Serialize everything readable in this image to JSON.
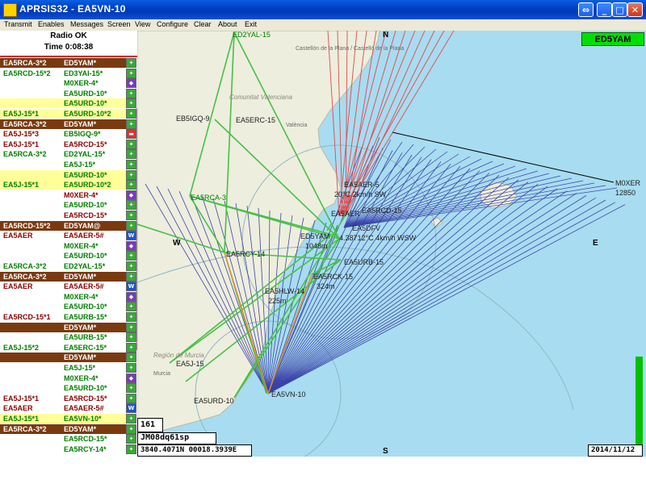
{
  "window": {
    "title": "APRSIS32 - EA5VN-10"
  },
  "menu": [
    "Transmit",
    "Enables",
    "Messages",
    "Screen",
    "View",
    "Configure",
    "Clear",
    "About",
    "Exit"
  ],
  "status": {
    "line1": "Radio OK",
    "line2": "Time 0:08:38"
  },
  "list": [
    {
      "c1": "EA5RCA-3*2",
      "c2": "ED5YAM*",
      "bg": "#7a3a10",
      "fg1": "#ffffff",
      "fg2": "#ffffff",
      "icon": "digi-icon"
    },
    {
      "c1": "EA5RCD-15*2",
      "c2": "ED3YAI-15*",
      "bg": "#ffffff",
      "fg1": "#008000",
      "fg2": "#008000",
      "icon": "digi-icon"
    },
    {
      "c1": "",
      "c2": "M0XER-4*",
      "bg": "#ffffff",
      "fg1": "#008000",
      "fg2": "#008000",
      "icon": "balloon-icon"
    },
    {
      "c1": "",
      "c2": "EA5URD-10*",
      "bg": "#ffffff",
      "fg1": "#008000",
      "fg2": "#008000",
      "icon": "digi-icon"
    },
    {
      "c1": "",
      "c2": "EA5URD-10*",
      "bg": "#ffff99",
      "fg1": "#008000",
      "fg2": "#008000",
      "icon": "digi-icon"
    },
    {
      "c1": "EA5J-15*1",
      "c2": "EA5URD-10*2",
      "bg": "#ffff99",
      "fg1": "#008000",
      "fg2": "#008000",
      "icon": "digi-icon"
    },
    {
      "c1": "EA5RCA-3*2",
      "c2": "ED5YAM*",
      "bg": "#7a3a10",
      "fg1": "#ffffff",
      "fg2": "#ffffff",
      "icon": "digi-icon"
    },
    {
      "c1": "EA5J-15*3",
      "c2": "EB5IGQ-9*",
      "bg": "#ffffff",
      "fg1": "#8b0000",
      "fg2": "#008000",
      "icon": "car-icon"
    },
    {
      "c1": "EA5J-15*1",
      "c2": "EA5RCD-15*",
      "bg": "#ffffff",
      "fg1": "#8b0000",
      "fg2": "#8b0000",
      "icon": "digi-icon"
    },
    {
      "c1": "EA5RCA-3*2",
      "c2": "ED2YAL-15*",
      "bg": "#ffffff",
      "fg1": "#008000",
      "fg2": "#008000",
      "icon": "digi-icon"
    },
    {
      "c1": "",
      "c2": "EA5J-15*",
      "bg": "#ffffff",
      "fg1": "#008000",
      "fg2": "#008000",
      "icon": "digi-icon"
    },
    {
      "c1": "",
      "c2": "EA5URD-10*",
      "bg": "#ffff99",
      "fg1": "#008000",
      "fg2": "#008000",
      "icon": "digi-icon"
    },
    {
      "c1": "EA5J-15*1",
      "c2": "EA5URD-10*2",
      "bg": "#ffff99",
      "fg1": "#008000",
      "fg2": "#008000",
      "icon": "digi-icon"
    },
    {
      "c1": "",
      "c2": "M0XER-4*",
      "bg": "#ffffff",
      "fg1": "#008000",
      "fg2": "#8b0000",
      "icon": "balloon-icon"
    },
    {
      "c1": "",
      "c2": "EA5URD-10*",
      "bg": "#ffffff",
      "fg1": "#008000",
      "fg2": "#008000",
      "icon": "digi-icon"
    },
    {
      "c1": "",
      "c2": "EA5RCD-15*",
      "bg": "#ffffff",
      "fg1": "#8b0000",
      "fg2": "#8b0000",
      "icon": "digi-icon"
    },
    {
      "c1": "EA5RCD-15*2",
      "c2": "ED5YAM@",
      "bg": "#7a3a10",
      "fg1": "#ffffff",
      "fg2": "#ffffff",
      "icon": "digi-icon"
    },
    {
      "c1": "EA5AER",
      "c2": "EA5AER-5#",
      "bg": "#ffffff",
      "fg1": "#8b0000",
      "fg2": "#8b0000",
      "icon": "wx-icon"
    },
    {
      "c1": "",
      "c2": "M0XER-4*",
      "bg": "#ffffff",
      "fg1": "#008000",
      "fg2": "#008000",
      "icon": "balloon-icon"
    },
    {
      "c1": "",
      "c2": "EA5URD-10*",
      "bg": "#ffffff",
      "fg1": "#008000",
      "fg2": "#008000",
      "icon": "digi-icon"
    },
    {
      "c1": "EA5RCA-3*2",
      "c2": "ED2YAL-15*",
      "bg": "#ffffff",
      "fg1": "#008000",
      "fg2": "#008000",
      "icon": "digi-icon"
    },
    {
      "c1": "EA5RCA-3*2",
      "c2": "ED5YAM*",
      "bg": "#7a3a10",
      "fg1": "#ffffff",
      "fg2": "#ffffff",
      "icon": "digi-icon"
    },
    {
      "c1": "EA5AER",
      "c2": "EA5AER-5#",
      "bg": "#ffffff",
      "fg1": "#8b0000",
      "fg2": "#8b0000",
      "icon": "wx-icon"
    },
    {
      "c1": "",
      "c2": "M0XER-4*",
      "bg": "#ffffff",
      "fg1": "#008000",
      "fg2": "#008000",
      "icon": "balloon-icon"
    },
    {
      "c1": "",
      "c2": "EA5URD-10*",
      "bg": "#ffffff",
      "fg1": "#008000",
      "fg2": "#008000",
      "icon": "digi-icon"
    },
    {
      "c1": "EA5RCD-15*1",
      "c2": "EA5URB-15*",
      "bg": "#ffffff",
      "fg1": "#8b0000",
      "fg2": "#008000",
      "icon": "digi-icon"
    },
    {
      "c1": "",
      "c2": "ED5YAM*",
      "bg": "#7a3a10",
      "fg1": "#ffffff",
      "fg2": "#ffffff",
      "icon": "digi-icon"
    },
    {
      "c1": "",
      "c2": "EA5URB-15*",
      "bg": "#ffffff",
      "fg1": "#008000",
      "fg2": "#008000",
      "icon": "digi-icon"
    },
    {
      "c1": "EA5J-15*2",
      "c2": "EA5ERC-15*",
      "bg": "#ffffff",
      "fg1": "#008000",
      "fg2": "#008000",
      "icon": "digi-icon"
    },
    {
      "c1": "",
      "c2": "ED5YAM*",
      "bg": "#7a3a10",
      "fg1": "#ffffff",
      "fg2": "#ffffff",
      "icon": "digi-icon"
    },
    {
      "c1": "",
      "c2": "EA5J-15*",
      "bg": "#ffffff",
      "fg1": "#008000",
      "fg2": "#008000",
      "icon": "digi-icon"
    },
    {
      "c1": "",
      "c2": "M0XER-4*",
      "bg": "#ffffff",
      "fg1": "#008000",
      "fg2": "#008000",
      "icon": "balloon-icon"
    },
    {
      "c1": "",
      "c2": "EA5URD-10*",
      "bg": "#ffffff",
      "fg1": "#008000",
      "fg2": "#008000",
      "icon": "digi-icon"
    },
    {
      "c1": "EA5J-15*1",
      "c2": "EA5RCD-15*",
      "bg": "#ffffff",
      "fg1": "#8b0000",
      "fg2": "#8b0000",
      "icon": "digi-icon"
    },
    {
      "c1": "EA5AER",
      "c2": "EA5AER-5#",
      "bg": "#ffffff",
      "fg1": "#8b0000",
      "fg2": "#8b0000",
      "icon": "wx-icon"
    },
    {
      "c1": "EA5J-15*1",
      "c2": "EA5VN-10*",
      "bg": "#ffff99",
      "fg1": "#008000",
      "fg2": "#008000",
      "icon": "digi-icon"
    },
    {
      "c1": "EA5RCA-3*2",
      "c2": "ED5YAM*",
      "bg": "#7a3a10",
      "fg1": "#ffffff",
      "fg2": "#ffffff",
      "icon": "digi-icon"
    },
    {
      "c1": "",
      "c2": "EA5RCD-15*",
      "bg": "#ffffff",
      "fg1": "#008000",
      "fg2": "#008000",
      "icon": "digi-icon"
    },
    {
      "c1": "",
      "c2": "EA5RCY-14*",
      "bg": "#ffffff",
      "fg1": "#008000",
      "fg2": "#008000",
      "icon": "digi-icon"
    }
  ],
  "scroll": {
    "up": "+",
    "down": "-"
  },
  "map": {
    "compass": {
      "n": "N",
      "s": "S",
      "e": "E",
      "w": "W"
    },
    "stations": [
      {
        "label": "ED2YAL-15",
        "color": "#008000"
      },
      {
        "label": "EB5IGQ-9",
        "color": "#202020"
      },
      {
        "label": "EA5ERC-15",
        "color": "#202020"
      },
      {
        "label": "EA5RCA-3",
        "color": "#008000"
      },
      {
        "label": "EA5AER-5",
        "color": "#202020"
      },
      {
        "label": "20°C 2km/h SW",
        "color": "#202020"
      },
      {
        "label": "EA5AER",
        "color": "#202020"
      },
      {
        "label": "EA5RCD-15",
        "color": "#202020"
      },
      {
        "label": "EA5DFV",
        "color": "#202020"
      },
      {
        "label": "ED5YAM",
        "color": "#202020"
      },
      {
        "label": "1048m",
        "color": "#202020"
      },
      {
        "label": "4.38712°C 4km/h WSW",
        "color": "#202020"
      },
      {
        "label": "EA5URB-15",
        "color": "#202020"
      },
      {
        "label": "EA5RCY-14",
        "color": "#202020"
      },
      {
        "label": "EA5RCK-15",
        "color": "#202020"
      },
      {
        "label": "324m",
        "color": "#202020"
      },
      {
        "label": "EA5HLW-14",
        "color": "#202020"
      },
      {
        "label": "225m",
        "color": "#202020"
      },
      {
        "label": "EA5J-15",
        "color": "#202020"
      },
      {
        "label": "EA5URD-10",
        "color": "#202020"
      },
      {
        "label": "EA5VN-10",
        "color": "#202020"
      },
      {
        "label": "M0XER",
        "color": "#202020"
      },
      {
        "label": "12850",
        "color": "#202020"
      }
    ],
    "places": [
      {
        "label": "Castellón de la Plana / Castelló de la Plana"
      },
      {
        "label": "Comunitat Valenciana"
      },
      {
        "label": "València"
      },
      {
        "label": "Región de Murcia"
      },
      {
        "label": "Murcia"
      }
    ],
    "badge": "ED5YAM"
  },
  "bottom": {
    "count": "161",
    "locator": "JM08dq61sp",
    "coords": "3840.4071N 00018.3939E",
    "date": "2014/11/12"
  }
}
